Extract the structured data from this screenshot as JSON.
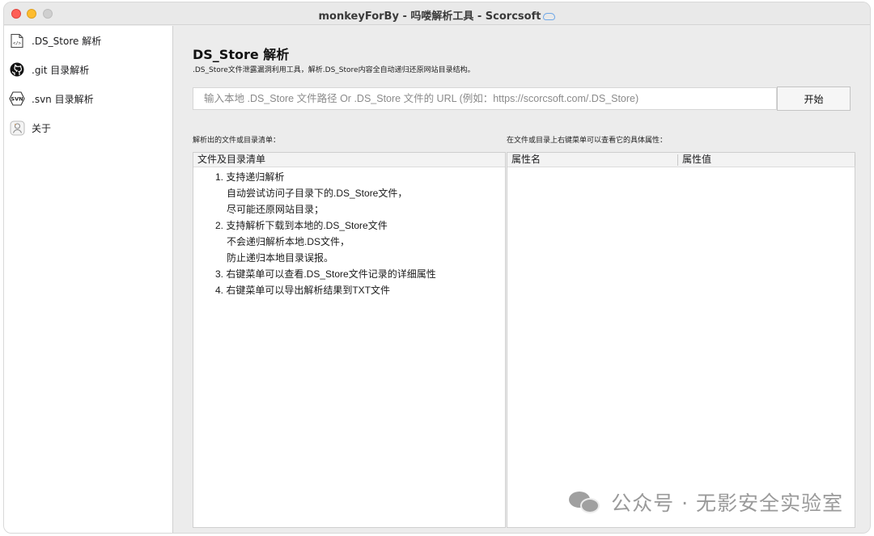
{
  "window": {
    "title": "monkeyForBy - 吗喽解析工具 - Scorcsoft"
  },
  "sidebar": {
    "items": [
      {
        "label": ".DS_Store 解析",
        "icon": "code-file-icon"
      },
      {
        "label": ".git 目录解析",
        "icon": "github-icon"
      },
      {
        "label": ".svn 目录解析",
        "icon": "svn-icon"
      },
      {
        "label": "关于",
        "icon": "about-icon"
      }
    ]
  },
  "main": {
    "title": "DS_Store 解析",
    "subtitle": ".DS_Store文件泄露漏洞利用工具，解析.DS_Store内容全自动递归还原网站目录结构。",
    "url_input": {
      "value": "",
      "placeholder": "输入本地 .DS_Store 文件路径 Or .DS_Store 文件的 URL (例如：https://scorcsoft.com/.DS_Store)"
    },
    "start_button": "开始",
    "left_label": "解析出的文件或目录清单：",
    "right_label": "在文件或目录上右键菜单可以查看它的具体属性：",
    "file_list": {
      "header": "文件及目录清单",
      "rows": [
        "1. 支持递归解析",
        "自动尝试访问子目录下的.DS_Store文件，",
        "尽可能还原网站目录；",
        "2. 支持解析下载到本地的.DS_Store文件",
        "不会递归解析本地.DS文件，",
        "防止递归本地目录误报。",
        "3. 右键菜单可以查看.DS_Store文件记录的详细属性",
        "4. 右键菜单可以导出解析结果到TXT文件"
      ]
    },
    "properties": {
      "headers": [
        "属性名",
        "属性值"
      ]
    }
  },
  "watermark": {
    "text": "公众号 · 无影安全实验室",
    "icon": "wechat-icon"
  }
}
